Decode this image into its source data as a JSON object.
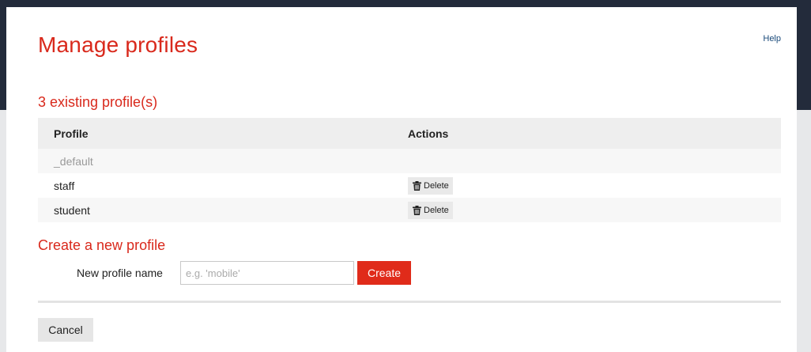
{
  "page": {
    "title": "Manage profiles",
    "help_label": "Help"
  },
  "profiles_section": {
    "title": "3 existing profile(s)",
    "columns": [
      "Profile",
      "Actions"
    ],
    "rows": [
      {
        "name": "_default",
        "muted": true,
        "action": ""
      },
      {
        "name": "staff",
        "muted": false,
        "action": "Delete",
        "action_icon": "trash-icon"
      },
      {
        "name": "student",
        "muted": false,
        "action": "Delete",
        "action_icon": "trash-icon"
      }
    ]
  },
  "create_section": {
    "title": "Create a new profile",
    "field_label": "New profile name",
    "input_value": "",
    "input_placeholder": "e.g. 'mobile'",
    "create_label": "Create"
  },
  "footer": {
    "cancel_label": "Cancel"
  },
  "colors": {
    "accent": "#d9291c",
    "header_band": "#232b3b",
    "create_button": "#e02b1a"
  }
}
